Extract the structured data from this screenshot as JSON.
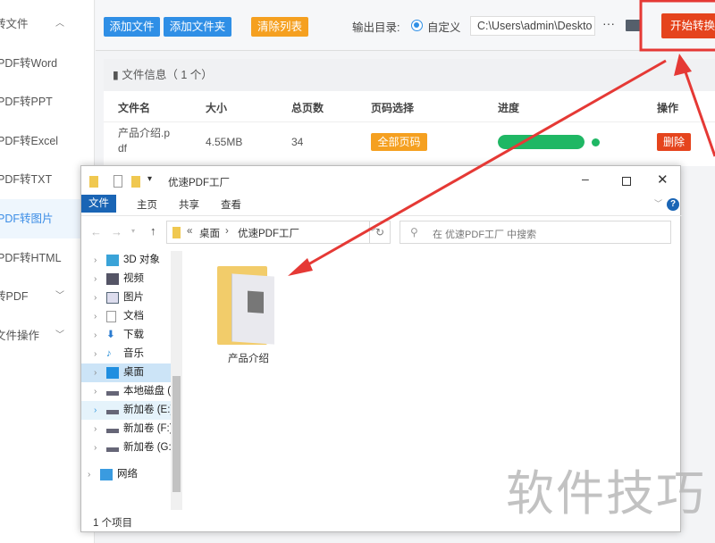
{
  "sidebar": {
    "items": [
      {
        "label": "转文件",
        "chevron": "^"
      },
      {
        "label": "PDF转Word"
      },
      {
        "label": "PDF转PPT"
      },
      {
        "label": "PDF转Excel"
      },
      {
        "label": "PDF转TXT"
      },
      {
        "label": "PDF转图片",
        "active": true
      },
      {
        "label": "PDF转HTML"
      },
      {
        "label": "转PDF",
        "chevron": "v"
      },
      {
        "label": "文件操作",
        "chevron": "v"
      }
    ]
  },
  "toolbar": {
    "add_file": "添加文件",
    "add_folder": "添加文件夹",
    "clear_list": "清除列表",
    "output_label": "输出目录:",
    "radio_label": "自定义",
    "output_path": "C:\\Users\\admin\\Deskto",
    "more": "···",
    "start": "开始转换"
  },
  "file_card": {
    "title": "文件信息（ 1 个）",
    "columns": [
      "文件名",
      "大小",
      "总页数",
      "页码选择",
      "进度",
      "操作"
    ],
    "rows": [
      {
        "name": "产品介绍.pdf",
        "name_l1": "产品介绍.p",
        "name_l2": "df",
        "size": "4.55MB",
        "pages": "34",
        "page_select": "全部页码",
        "progress": 1.0,
        "action": "删除"
      }
    ]
  },
  "explorer": {
    "title": "优速PDF工厂",
    "ribbon_tabs": [
      "文件",
      "主页",
      "共享",
      "查看"
    ],
    "breadcrumb": [
      "«",
      "桌面",
      "›",
      "优速PDF工厂"
    ],
    "search_placeholder": "在 优速PDF工厂 中搜索",
    "nav": [
      "3D 对象",
      "视频",
      "图片",
      "文档",
      "下载",
      "音乐",
      "桌面",
      "本地磁盘 (",
      "新加卷 (E:)",
      "新加卷 (F:)",
      "新加卷 (G:"
    ],
    "network": "网络",
    "items": [
      {
        "name": "产品介绍"
      }
    ],
    "status": "1 个项目"
  },
  "watermark": "软件技巧",
  "colors": {
    "blue": "#2f8fe6",
    "orange": "#f5a020",
    "red": "#e5441d",
    "green": "#1fb764",
    "annotation": "#e53935"
  }
}
